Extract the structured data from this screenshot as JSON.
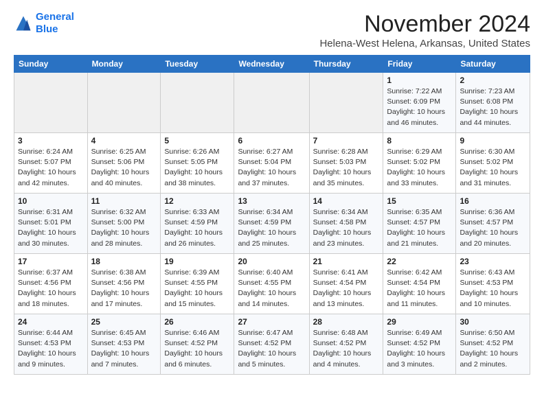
{
  "header": {
    "logo_line1": "General",
    "logo_line2": "Blue",
    "month_title": "November 2024",
    "location": "Helena-West Helena, Arkansas, United States"
  },
  "weekdays": [
    "Sunday",
    "Monday",
    "Tuesday",
    "Wednesday",
    "Thursday",
    "Friday",
    "Saturday"
  ],
  "weeks": [
    [
      {
        "day": "",
        "info": ""
      },
      {
        "day": "",
        "info": ""
      },
      {
        "day": "",
        "info": ""
      },
      {
        "day": "",
        "info": ""
      },
      {
        "day": "",
        "info": ""
      },
      {
        "day": "1",
        "info": "Sunrise: 7:22 AM\nSunset: 6:09 PM\nDaylight: 10 hours\nand 46 minutes."
      },
      {
        "day": "2",
        "info": "Sunrise: 7:23 AM\nSunset: 6:08 PM\nDaylight: 10 hours\nand 44 minutes."
      }
    ],
    [
      {
        "day": "3",
        "info": "Sunrise: 6:24 AM\nSunset: 5:07 PM\nDaylight: 10 hours\nand 42 minutes."
      },
      {
        "day": "4",
        "info": "Sunrise: 6:25 AM\nSunset: 5:06 PM\nDaylight: 10 hours\nand 40 minutes."
      },
      {
        "day": "5",
        "info": "Sunrise: 6:26 AM\nSunset: 5:05 PM\nDaylight: 10 hours\nand 38 minutes."
      },
      {
        "day": "6",
        "info": "Sunrise: 6:27 AM\nSunset: 5:04 PM\nDaylight: 10 hours\nand 37 minutes."
      },
      {
        "day": "7",
        "info": "Sunrise: 6:28 AM\nSunset: 5:03 PM\nDaylight: 10 hours\nand 35 minutes."
      },
      {
        "day": "8",
        "info": "Sunrise: 6:29 AM\nSunset: 5:02 PM\nDaylight: 10 hours\nand 33 minutes."
      },
      {
        "day": "9",
        "info": "Sunrise: 6:30 AM\nSunset: 5:02 PM\nDaylight: 10 hours\nand 31 minutes."
      }
    ],
    [
      {
        "day": "10",
        "info": "Sunrise: 6:31 AM\nSunset: 5:01 PM\nDaylight: 10 hours\nand 30 minutes."
      },
      {
        "day": "11",
        "info": "Sunrise: 6:32 AM\nSunset: 5:00 PM\nDaylight: 10 hours\nand 28 minutes."
      },
      {
        "day": "12",
        "info": "Sunrise: 6:33 AM\nSunset: 4:59 PM\nDaylight: 10 hours\nand 26 minutes."
      },
      {
        "day": "13",
        "info": "Sunrise: 6:34 AM\nSunset: 4:59 PM\nDaylight: 10 hours\nand 25 minutes."
      },
      {
        "day": "14",
        "info": "Sunrise: 6:34 AM\nSunset: 4:58 PM\nDaylight: 10 hours\nand 23 minutes."
      },
      {
        "day": "15",
        "info": "Sunrise: 6:35 AM\nSunset: 4:57 PM\nDaylight: 10 hours\nand 21 minutes."
      },
      {
        "day": "16",
        "info": "Sunrise: 6:36 AM\nSunset: 4:57 PM\nDaylight: 10 hours\nand 20 minutes."
      }
    ],
    [
      {
        "day": "17",
        "info": "Sunrise: 6:37 AM\nSunset: 4:56 PM\nDaylight: 10 hours\nand 18 minutes."
      },
      {
        "day": "18",
        "info": "Sunrise: 6:38 AM\nSunset: 4:56 PM\nDaylight: 10 hours\nand 17 minutes."
      },
      {
        "day": "19",
        "info": "Sunrise: 6:39 AM\nSunset: 4:55 PM\nDaylight: 10 hours\nand 15 minutes."
      },
      {
        "day": "20",
        "info": "Sunrise: 6:40 AM\nSunset: 4:55 PM\nDaylight: 10 hours\nand 14 minutes."
      },
      {
        "day": "21",
        "info": "Sunrise: 6:41 AM\nSunset: 4:54 PM\nDaylight: 10 hours\nand 13 minutes."
      },
      {
        "day": "22",
        "info": "Sunrise: 6:42 AM\nSunset: 4:54 PM\nDaylight: 10 hours\nand 11 minutes."
      },
      {
        "day": "23",
        "info": "Sunrise: 6:43 AM\nSunset: 4:53 PM\nDaylight: 10 hours\nand 10 minutes."
      }
    ],
    [
      {
        "day": "24",
        "info": "Sunrise: 6:44 AM\nSunset: 4:53 PM\nDaylight: 10 hours\nand 9 minutes."
      },
      {
        "day": "25",
        "info": "Sunrise: 6:45 AM\nSunset: 4:53 PM\nDaylight: 10 hours\nand 7 minutes."
      },
      {
        "day": "26",
        "info": "Sunrise: 6:46 AM\nSunset: 4:52 PM\nDaylight: 10 hours\nand 6 minutes."
      },
      {
        "day": "27",
        "info": "Sunrise: 6:47 AM\nSunset: 4:52 PM\nDaylight: 10 hours\nand 5 minutes."
      },
      {
        "day": "28",
        "info": "Sunrise: 6:48 AM\nSunset: 4:52 PM\nDaylight: 10 hours\nand 4 minutes."
      },
      {
        "day": "29",
        "info": "Sunrise: 6:49 AM\nSunset: 4:52 PM\nDaylight: 10 hours\nand 3 minutes."
      },
      {
        "day": "30",
        "info": "Sunrise: 6:50 AM\nSunset: 4:52 PM\nDaylight: 10 hours\nand 2 minutes."
      }
    ]
  ]
}
